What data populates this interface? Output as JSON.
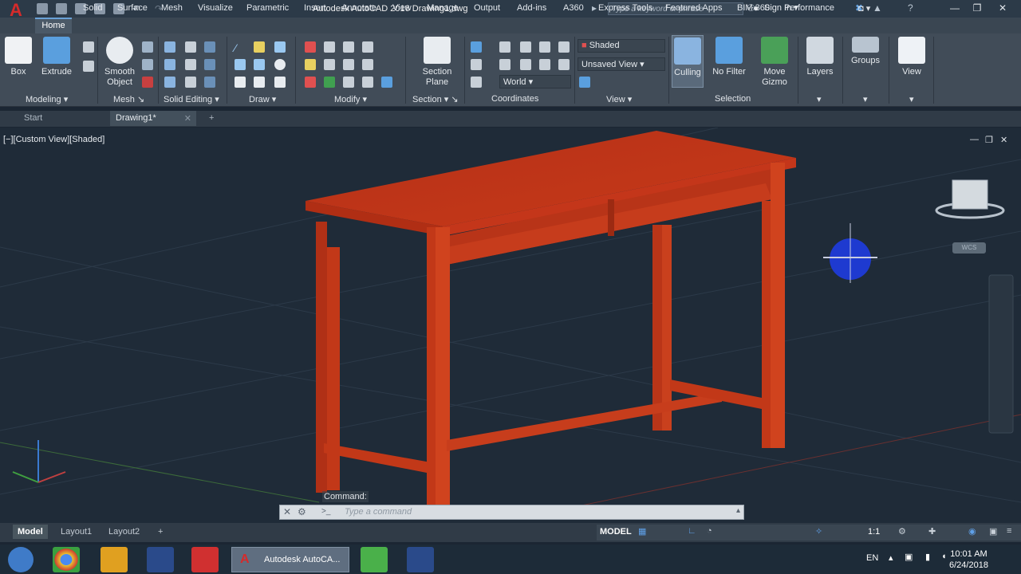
{
  "app": {
    "logo": "A",
    "title": "Autodesk AutoCAD 2016    Drawing1.dwg",
    "search_placeholder": "Type a keyword or phrase",
    "sign_in": "Sign In"
  },
  "tabs": [
    "Home",
    "Solid",
    "Surface",
    "Mesh",
    "Visualize",
    "Parametric",
    "Insert",
    "Annotate",
    "View",
    "Manage",
    "Output",
    "Add-ins",
    "A360",
    "Express Tools",
    "Featured Apps",
    "BIM 360",
    "Performance"
  ],
  "ribbon": {
    "buttons": {
      "box": "Box",
      "extrude": "Extrude",
      "smooth1": "Smooth",
      "smooth2": "Object",
      "section1": "Section",
      "section2": "Plane",
      "culling": "Culling",
      "nofilter": "No Filter",
      "gizmo1": "Move",
      "gizmo2": "Gizmo",
      "layers": "Layers",
      "groups": "Groups",
      "view": "View"
    },
    "dropdowns": {
      "visual_style": "Shaded",
      "view": "Unsaved View",
      "coords": "World"
    },
    "panels": {
      "modeling": "Modeling",
      "mesh": "Mesh",
      "solid_editing": "Solid Editing",
      "draw": "Draw",
      "modify": "Modify",
      "section": "Section",
      "coordinates": "Coordinates",
      "view": "View",
      "selection": "Selection"
    }
  },
  "file_tabs": {
    "start": "Start",
    "drawing": "Drawing1*",
    "add": "+"
  },
  "viewport": {
    "label": "[−][Custom View][Shaded]",
    "model_color": "#c23a17"
  },
  "command": {
    "history": "Command:",
    "placeholder": "Type a command"
  },
  "layout_tabs": [
    "Model",
    "Layout1",
    "Layout2"
  ],
  "status": {
    "model": "MODEL",
    "scale": "1:1"
  },
  "taskbar": {
    "active_app": "Autodesk AutoCA...",
    "lang": "EN",
    "time": "10:01 AM",
    "date": "6/24/2018"
  }
}
